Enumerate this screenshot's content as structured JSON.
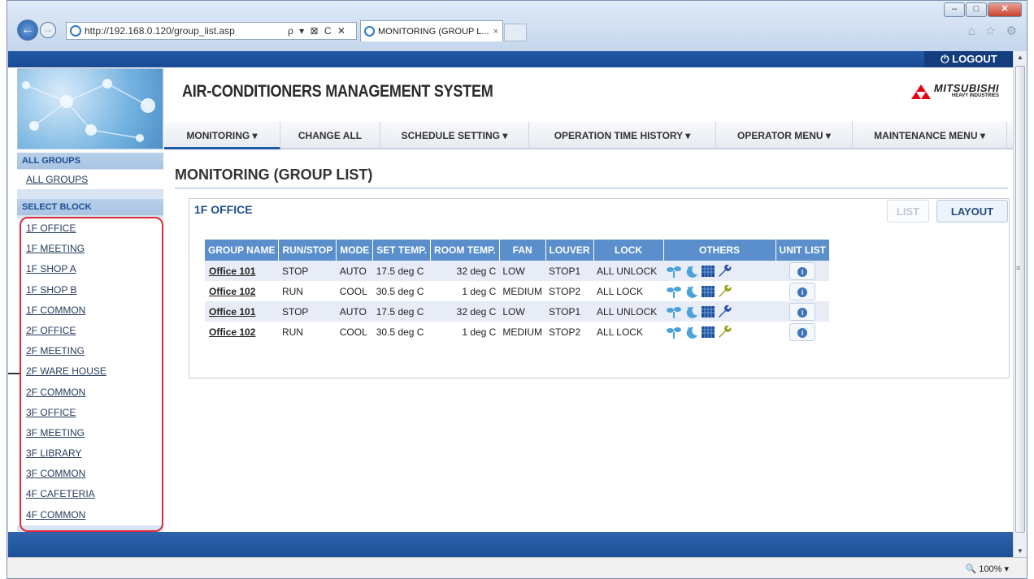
{
  "browser": {
    "url": "http://192.168.0.120/group_list.asp",
    "address_actions": "ρ ▾ ⊠ C ✕",
    "tab_title": "MONITORING (GROUP L...",
    "tab_close": "×",
    "toolbar_icons": "⌂ ☆ ⚙",
    "window_controls": [
      "–",
      "□",
      "✕"
    ],
    "zoom": "🔍 100%  ▾"
  },
  "header": {
    "logout": "⏻ LOGOUT",
    "title": "AIR-CONDITIONERS MANAGEMENT SYSTEM",
    "logo_line1": "MITSUBISHI",
    "logo_line2": "HEAVY INDUSTRIES",
    "logo_color": "#e60012"
  },
  "nav": [
    {
      "label": "MONITORING ▾"
    },
    {
      "label": "CHANGE ALL"
    },
    {
      "label": "SCHEDULE SETTING ▾"
    },
    {
      "label": "OPERATION TIME HISTORY ▾"
    },
    {
      "label": "OPERATOR MENU ▾"
    },
    {
      "label": "MAINTENANCE MENU ▾"
    }
  ],
  "sidebar": {
    "all_groups_header": "ALL GROUPS",
    "all_groups_link": "ALL GROUPS",
    "select_block_header": "SELECT BLOCK",
    "blocks": [
      "1F OFFICE",
      "1F MEETING",
      "1F SHOP A",
      "1F SHOP B",
      "1F COMMON",
      "2F OFFICE",
      "2F MEETING",
      "2F WARE HOUSE",
      "2F COMMON",
      "3F OFFICE",
      "3F MEETING",
      "3F LIBRARY",
      "3F COMMON",
      "4F CAFETERIA",
      "4F COMMON"
    ]
  },
  "main": {
    "page_title": "MONITORING (GROUP LIST)",
    "section_title": "1F OFFICE",
    "list_button": "LIST",
    "layout_button": "LAYOUT",
    "columns": [
      "GROUP NAME",
      "RUN/STOP",
      "MODE",
      "SET TEMP.",
      "ROOM TEMP.",
      "FAN",
      "LOUVER",
      "LOCK",
      "OTHERS",
      "UNIT LIST"
    ],
    "rows": [
      {
        "group": "Office 101",
        "run": "STOP",
        "mode": "AUTO",
        "set": "17.5 deg C",
        "room": "32 deg C",
        "fan": "LOW",
        "louver": "STOP1",
        "lock": "ALL UNLOCK",
        "wrench_color": "#2a55a8"
      },
      {
        "group": "Office 102",
        "run": "RUN",
        "mode": "COOL",
        "set": "30.5 deg C",
        "room": "1 deg C",
        "fan": "MEDIUM",
        "louver": "STOP2",
        "lock": "ALL LOCK",
        "wrench_color": "#9aa21a"
      },
      {
        "group": "Office 101",
        "run": "STOP",
        "mode": "AUTO",
        "set": "17.5 deg C",
        "room": "32 deg C",
        "fan": "LOW",
        "louver": "STOP1",
        "lock": "ALL UNLOCK",
        "wrench_color": "#2a55a8"
      },
      {
        "group": "Office 102",
        "run": "RUN",
        "mode": "COOL",
        "set": "30.5 deg C",
        "room": "1 deg C",
        "fan": "MEDIUM",
        "louver": "STOP2",
        "lock": "ALL LOCK",
        "wrench_color": "#9aa21a"
      }
    ],
    "info_icon": "i"
  },
  "colors": {
    "header_blue": "#1f5aa6",
    "table_header": "#5b8fcc",
    "row_alt": "#e8ecf7",
    "highlight": "#e02838"
  }
}
